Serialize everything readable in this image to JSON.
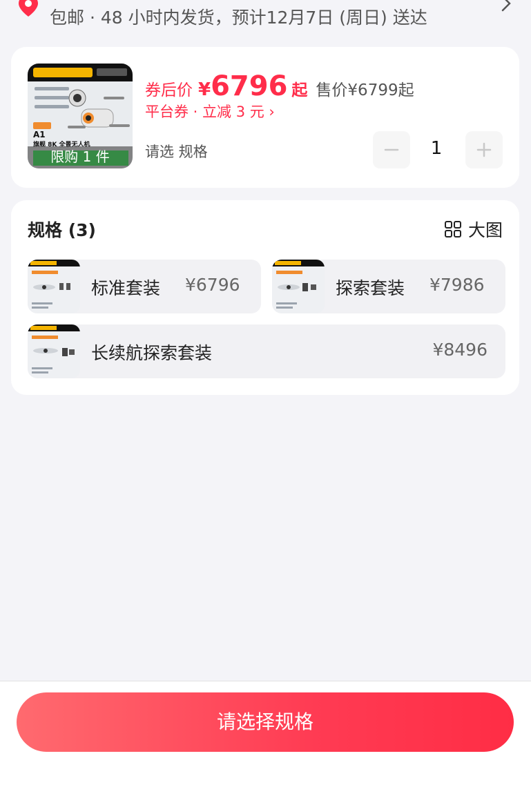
{
  "shipping": {
    "text": "包邮 · 48 小时内发货，预计12月7日 (周日) 送达"
  },
  "product": {
    "limit_badge": "限购 1 件",
    "thumb_model": "A1",
    "thumb_sub": "旗舰 8K 全景无人机",
    "coupon_label": "券后价",
    "currency": "¥",
    "price": "6796",
    "price_suffix": "起",
    "sale_price": "售价¥6799起",
    "coupon_line": "平台券 · 立减 3 元 ›",
    "select_prompt": "请选 规格",
    "quantity": "1"
  },
  "spec": {
    "title": "规格 (3)",
    "view_toggle": "大图",
    "options": [
      {
        "name": "标准套装",
        "price": "¥6796"
      },
      {
        "name": "探索套装",
        "price": "¥7986"
      },
      {
        "name": "长续航探索套装",
        "price": "¥8496"
      }
    ]
  },
  "cta": {
    "label": "请选择规格"
  },
  "colors": {
    "accent": "#ff2d4a",
    "cta_start": "#ff6a6f",
    "cta_end": "#ff2d45",
    "background": "#f4f4f8"
  },
  "icons": [
    "location-pin-icon",
    "chevron-right-icon",
    "minus-icon",
    "plus-icon",
    "grid-icon"
  ]
}
